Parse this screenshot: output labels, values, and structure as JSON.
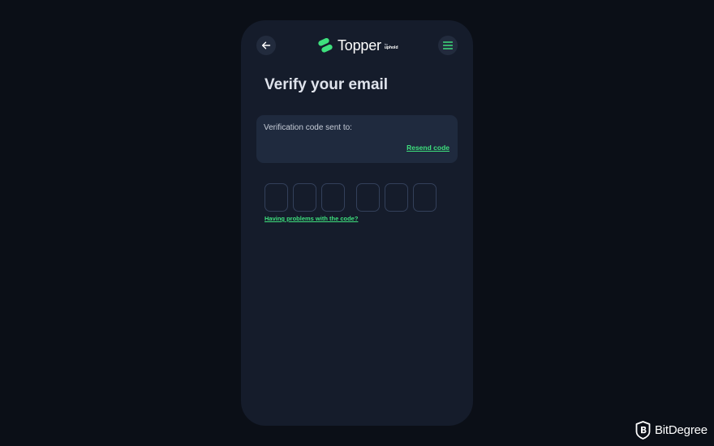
{
  "header": {
    "back_icon": "arrow-left-icon",
    "menu_icon": "hamburger-menu-icon",
    "brand_name": "Topper",
    "brand_by": "by",
    "brand_by_name": "uphold"
  },
  "main": {
    "title": "Verify your email",
    "info_text": "Verification code sent to:",
    "resend_label": "Resend code",
    "code_digits": [
      "",
      "",
      "",
      "",
      "",
      ""
    ],
    "problems_label": "Having problems with the code?"
  },
  "watermark": {
    "text": "BitDegree"
  },
  "colors": {
    "background": "#0b0f17",
    "panel": "#151c2b",
    "card": "#1f2a3e",
    "accent": "#3ee07d",
    "text": "#dfe3ec"
  }
}
